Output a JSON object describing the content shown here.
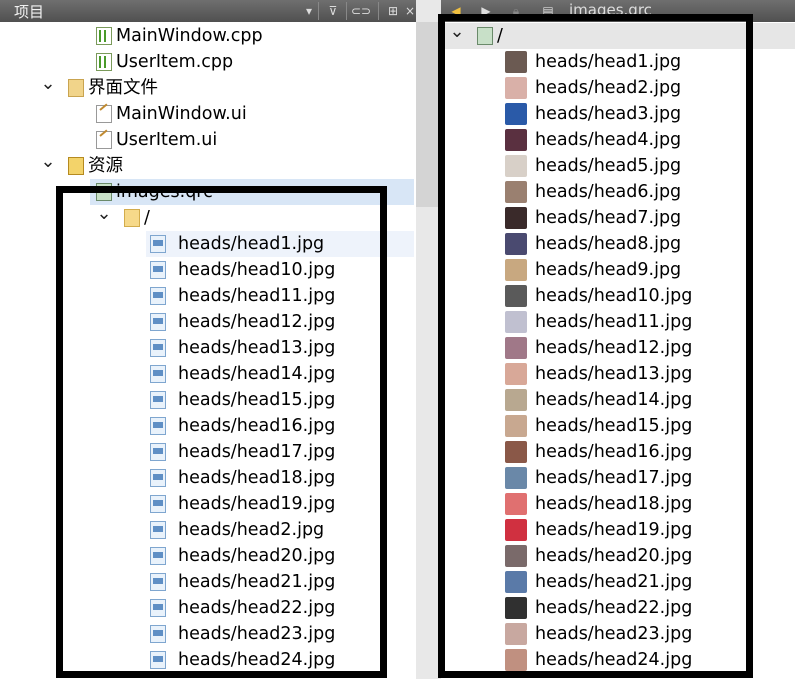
{
  "left_panel": {
    "title": "项目",
    "toolbar_icons": [
      "dropdown-icon",
      "filter-icon",
      "link-icon",
      "split-icon",
      "close-icon"
    ],
    "tree": [
      {
        "label": "MainWindow.cpp",
        "icon": "cpp-file-icon"
      },
      {
        "label": "UserItem.cpp",
        "icon": "cpp-file-icon"
      },
      {
        "label": "界面文件",
        "icon": "forms-folder-icon",
        "expanded": true
      },
      {
        "label": "MainWindow.ui",
        "icon": "ui-file-icon"
      },
      {
        "label": "UserItem.ui",
        "icon": "ui-file-icon"
      },
      {
        "label": "资源",
        "icon": "resources-lock-icon",
        "expanded": true
      },
      {
        "label": "images.qrc",
        "icon": "qrc-file-icon",
        "expanded": true
      },
      {
        "label": "/",
        "icon": "folder-icon",
        "expanded": true
      }
    ],
    "files": [
      "heads/head1.jpg",
      "heads/head10.jpg",
      "heads/head11.jpg",
      "heads/head12.jpg",
      "heads/head13.jpg",
      "heads/head14.jpg",
      "heads/head15.jpg",
      "heads/head16.jpg",
      "heads/head17.jpg",
      "heads/head18.jpg",
      "heads/head19.jpg",
      "heads/head2.jpg",
      "heads/head20.jpg",
      "heads/head21.jpg",
      "heads/head22.jpg",
      "heads/head23.jpg",
      "heads/head24.jpg"
    ]
  },
  "right_panel": {
    "file_tab": "images.qrc",
    "toolbar_icons": [
      "back-icon",
      "forward-icon",
      "lock-icon"
    ],
    "root": "/",
    "files": [
      {
        "label": "heads/head1.jpg",
        "color": "#6b5a52"
      },
      {
        "label": "heads/head2.jpg",
        "color": "#d9b0a8"
      },
      {
        "label": "heads/head3.jpg",
        "color": "#2a5aa8"
      },
      {
        "label": "heads/head4.jpg",
        "color": "#5a3040"
      },
      {
        "label": "heads/head5.jpg",
        "color": "#d8d0c8"
      },
      {
        "label": "heads/head6.jpg",
        "color": "#9a8070"
      },
      {
        "label": "heads/head7.jpg",
        "color": "#3a2a2a"
      },
      {
        "label": "heads/head8.jpg",
        "color": "#4a4a70"
      },
      {
        "label": "heads/head9.jpg",
        "color": "#c8a880"
      },
      {
        "label": "heads/head10.jpg",
        "color": "#5a5a5a"
      },
      {
        "label": "heads/head11.jpg",
        "color": "#c0c0d0"
      },
      {
        "label": "heads/head12.jpg",
        "color": "#a07888"
      },
      {
        "label": "heads/head13.jpg",
        "color": "#d8a898"
      },
      {
        "label": "heads/head14.jpg",
        "color": "#b8a890"
      },
      {
        "label": "heads/head15.jpg",
        "color": "#c8a890"
      },
      {
        "label": "heads/head16.jpg",
        "color": "#8a5848"
      },
      {
        "label": "heads/head17.jpg",
        "color": "#6a88a8"
      },
      {
        "label": "heads/head18.jpg",
        "color": "#e07070"
      },
      {
        "label": "heads/head19.jpg",
        "color": "#d03040"
      },
      {
        "label": "heads/head20.jpg",
        "color": "#7a6a6a"
      },
      {
        "label": "heads/head21.jpg",
        "color": "#5a7aa8"
      },
      {
        "label": "heads/head22.jpg",
        "color": "#303030"
      },
      {
        "label": "heads/head23.jpg",
        "color": "#c8a8a0"
      },
      {
        "label": "heads/head24.jpg",
        "color": "#c09080"
      }
    ]
  },
  "colors": {
    "selection": "#d8e6f6",
    "annotation_frame": "#000000",
    "toolbar": "#5a5a5a"
  }
}
